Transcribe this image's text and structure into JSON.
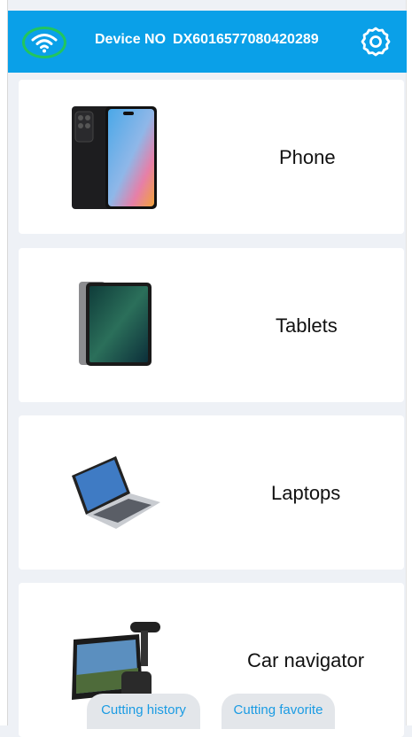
{
  "header": {
    "device_label": "Device NO",
    "device_number": "DX6016577080420289",
    "wifi_icon": "wifi-icon",
    "settings_icon": "gear-icon",
    "colors": {
      "bar": "#0aa0e8",
      "wifi_ring": "#22c55e"
    }
  },
  "categories": [
    {
      "label": "Phone",
      "icon": "phone-icon"
    },
    {
      "label": "Tablets",
      "icon": "tablet-icon"
    },
    {
      "label": "Laptops",
      "icon": "laptop-icon"
    },
    {
      "label": "Car navigator",
      "icon": "car-navigator-icon"
    }
  ],
  "bottom_tabs": [
    {
      "label": "Cutting history"
    },
    {
      "label": "Cutting favorite"
    }
  ]
}
